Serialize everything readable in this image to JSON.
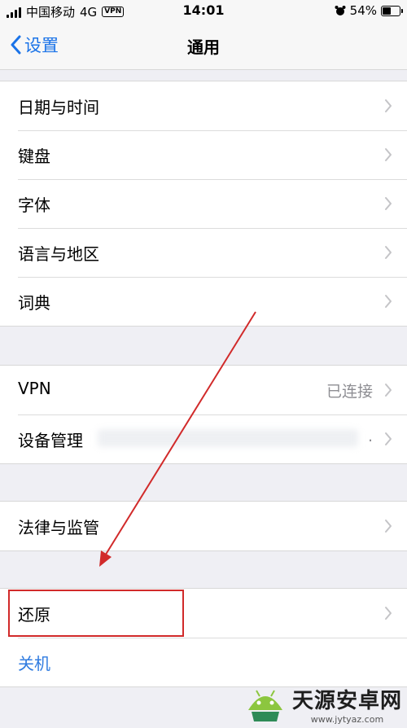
{
  "status_bar": {
    "carrier": "中国移动",
    "network": "4G",
    "vpn_badge": "VPN",
    "time": "14:01",
    "battery": "54%",
    "battery_level": 0.54
  },
  "nav": {
    "back_label": "设置",
    "title": "通用"
  },
  "group1": {
    "items": [
      {
        "label": "日期与时间"
      },
      {
        "label": "键盘"
      },
      {
        "label": "字体"
      },
      {
        "label": "语言与地区"
      },
      {
        "label": "词典"
      }
    ]
  },
  "group2": {
    "vpn": {
      "label": "VPN",
      "detail": "已连接"
    },
    "device": {
      "label": "设备管理",
      "detail": "."
    }
  },
  "group3": {
    "legal": {
      "label": "法律与监管"
    }
  },
  "group4": {
    "reset": {
      "label": "还原"
    },
    "shutdown": {
      "label": "关机"
    }
  },
  "watermark": {
    "brand": "天源安卓网",
    "url": "www.jytyaz.com"
  },
  "colors": {
    "accent": "#1a73e8",
    "annotation": "#d12a2a"
  }
}
